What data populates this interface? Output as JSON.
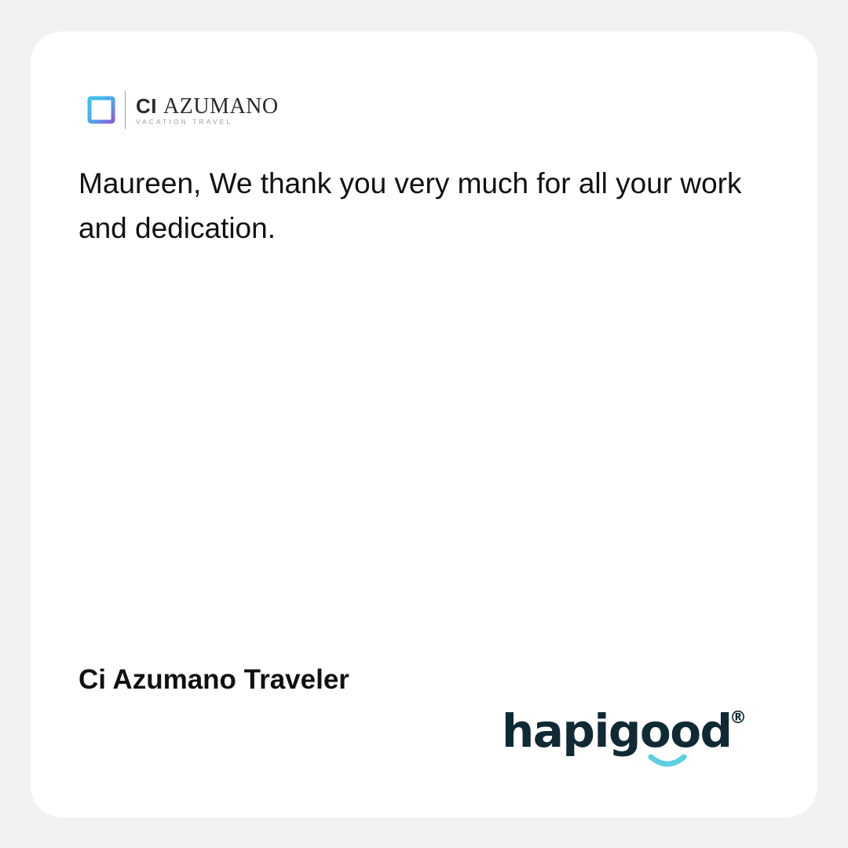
{
  "brand": {
    "name_prefix": "CI",
    "name_main": "AZUMANO",
    "tagline": "VACATION TRAVEL",
    "icon": "gradient-square-icon",
    "colors": {
      "mark_gradient_start": "#39c6e8",
      "mark_gradient_end": "#8a5bd9"
    }
  },
  "message": "Maureen, We thank you very much for all your work and dedication.",
  "author": "Ci Azumano Traveler",
  "footer_logo": {
    "word": "hapigood",
    "registered": "®",
    "colors": {
      "text": "#0f2a35",
      "smile": "#5ccfe0"
    }
  }
}
